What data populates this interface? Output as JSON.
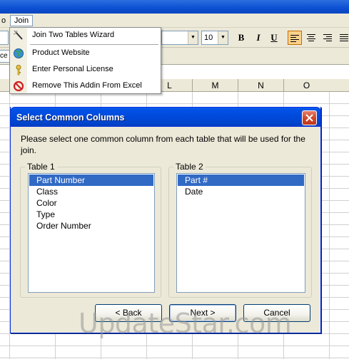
{
  "menubar": {
    "prev_item": "o",
    "join_menu": "Join"
  },
  "toolbar": {
    "font_size": "10",
    "bold": "B",
    "italic": "I",
    "underline": "U"
  },
  "formulabar": {
    "namebox_tail": "ce"
  },
  "sheet": {
    "columns": [
      "L",
      "M",
      "N",
      "O"
    ]
  },
  "join_menu": {
    "items": [
      {
        "label": "Join Two Tables Wizard",
        "icon": "wand-icon"
      },
      {
        "label": "Product Website",
        "icon": "globe-icon"
      },
      {
        "label": "Enter Personal License",
        "icon": "key-icon"
      },
      {
        "label": "Remove This Addin From Excel",
        "icon": "prohibited-icon"
      }
    ]
  },
  "dialog": {
    "title": "Select Common Columns",
    "instructions": "Please select one common column from each table that will be used for the join.",
    "table1": {
      "legend": "Table 1",
      "items": [
        "Part Number",
        "Class",
        "Color",
        "Type",
        "Order Number"
      ],
      "selected": "Part Number"
    },
    "table2": {
      "legend": "Table 2",
      "items": [
        "Part #",
        "Date"
      ],
      "selected": "Part #"
    },
    "buttons": {
      "back": "< Back",
      "next": "Next >",
      "cancel": "Cancel"
    }
  },
  "watermark": "UpdateStar.com",
  "colors": {
    "selection": "#316ac5",
    "titlebar": "#0049db",
    "close": "#d0482a"
  }
}
